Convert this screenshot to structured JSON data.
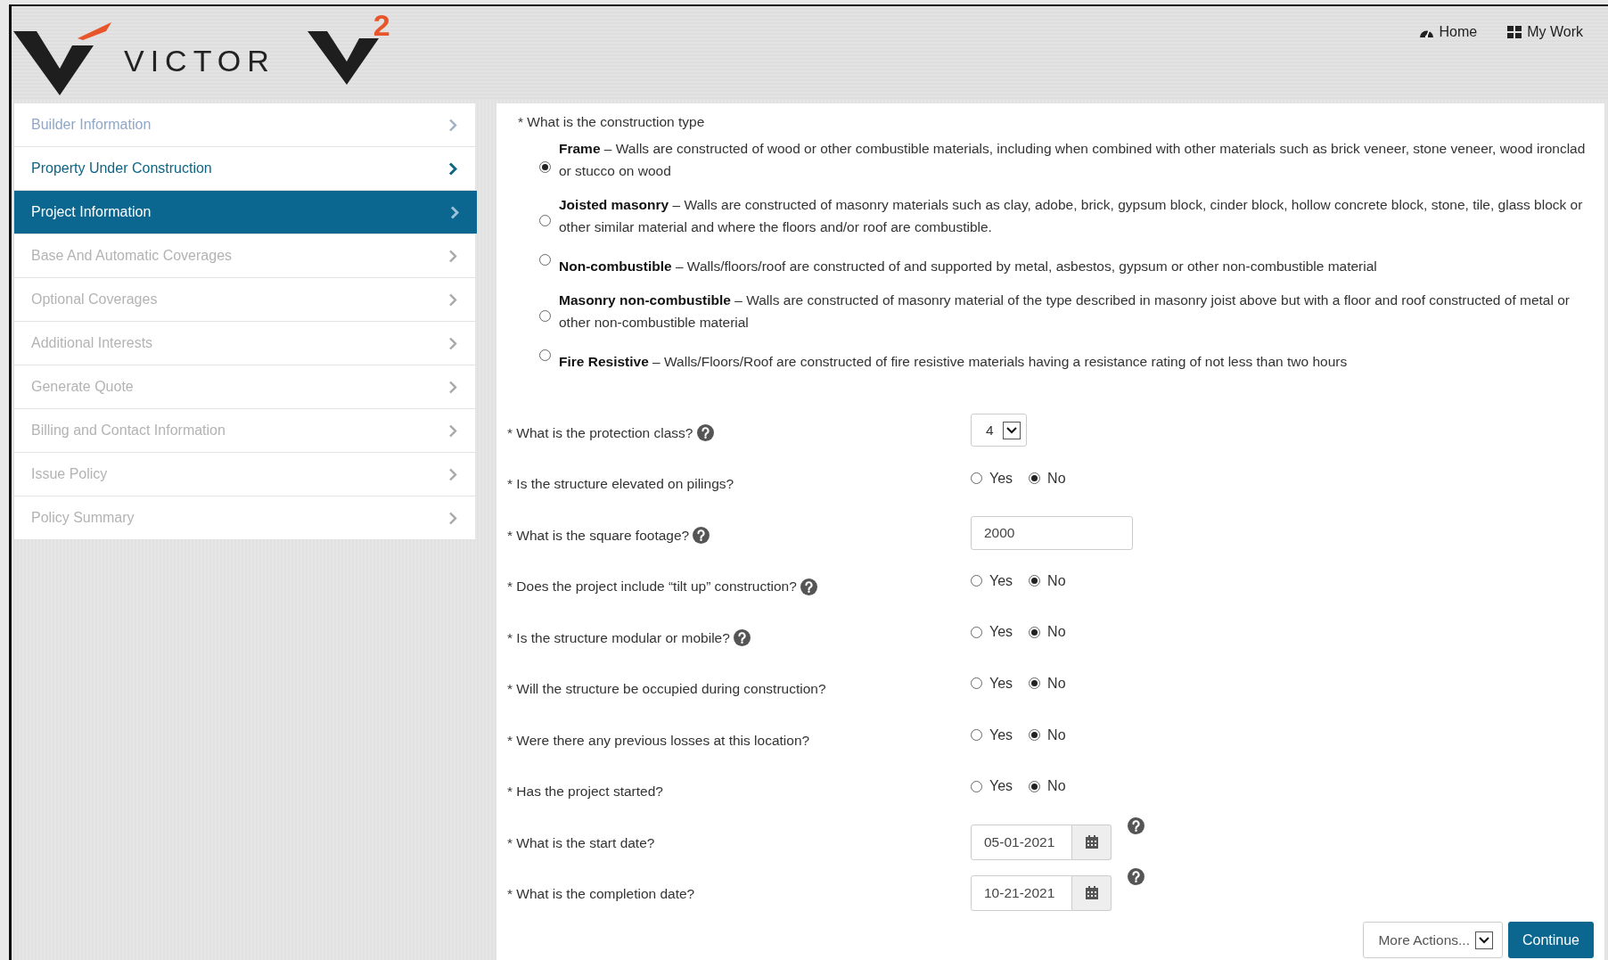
{
  "header": {
    "logo": {
      "wordmark": "VICTOR",
      "superscript": "2"
    },
    "nav": [
      {
        "label": "Home"
      },
      {
        "label": "My Work"
      }
    ]
  },
  "sidebar": {
    "items": [
      {
        "label": "Builder Information",
        "selected": false,
        "visited": true,
        "disabled": false
      },
      {
        "label": "Property Under Construction",
        "selected": false,
        "visited": false,
        "disabled": false
      },
      {
        "label": "Project Information",
        "selected": true,
        "visited": false,
        "disabled": false
      },
      {
        "label": "Base And Automatic Coverages",
        "selected": false,
        "visited": false,
        "disabled": true
      },
      {
        "label": "Optional Coverages",
        "selected": false,
        "visited": false,
        "disabled": true
      },
      {
        "label": "Additional Interests",
        "selected": false,
        "visited": false,
        "disabled": true
      },
      {
        "label": "Generate Quote",
        "selected": false,
        "visited": false,
        "disabled": true
      },
      {
        "label": "Billing and Contact Information",
        "selected": false,
        "visited": false,
        "disabled": true
      },
      {
        "label": "Issue Policy",
        "selected": false,
        "visited": false,
        "disabled": true
      },
      {
        "label": "Policy Summary",
        "selected": false,
        "visited": false,
        "disabled": true
      }
    ]
  },
  "construction_type": {
    "question": "* What is the construction type",
    "options": [
      {
        "text": "**Frame** – Walls are constructed of wood or other combustible materials, including when combined with other materials such as brick veneer, stone veneer, wood ironclad or stucco on wood",
        "selected": true
      },
      {
        "text": "**Joisted masonry** – Walls are constructed of masonry materials such as clay, adobe, brick, gypsum block, cinder block, hollow concrete block, stone, tile, glass block or other similar material and where the floors and/or roof are combustible.",
        "selected": false
      },
      {
        "text": "**Non-combustible** – Walls/floors/roof are constructed of and supported by metal, asbestos, gypsum or other non-combustible material",
        "selected": false
      },
      {
        "text": "**Masonry non-combustible** – Walls are constructed of masonry material of the type described in masonry joist above but with a floor and roof constructed of metal or other non-combustible material",
        "selected": false
      },
      {
        "text": "**Fire Resistive** – Walls/Floors/Roof are constructed of fire resistive materials having a resistance rating of not less than two hours",
        "selected": false
      }
    ]
  },
  "questions": [
    {
      "kind": "select",
      "label": "* What is the protection class?",
      "help": true,
      "value": "4"
    },
    {
      "kind": "yesno",
      "label": "* Is the structure elevated on pilings?",
      "help": false,
      "options": [
        {
          "label": "Yes",
          "selected": false
        },
        {
          "label": "No",
          "selected": true
        }
      ]
    },
    {
      "kind": "text",
      "label": "* What is the square footage?",
      "help": true,
      "value": "2000"
    },
    {
      "kind": "yesno",
      "label": "* Does the project include “tilt up” construction?",
      "help": true,
      "options": [
        {
          "label": "Yes",
          "selected": false
        },
        {
          "label": "No",
          "selected": true
        }
      ]
    },
    {
      "kind": "yesno",
      "label": "* Is the structure modular or mobile?",
      "help": true,
      "options": [
        {
          "label": "Yes",
          "selected": false
        },
        {
          "label": "No",
          "selected": true
        }
      ]
    },
    {
      "kind": "yesno",
      "label": "* Will the structure be occupied during construction?",
      "help": false,
      "options": [
        {
          "label": "Yes",
          "selected": false
        },
        {
          "label": "No",
          "selected": true
        }
      ]
    },
    {
      "kind": "yesno",
      "label": "* Were there any previous losses at this location?",
      "help": false,
      "options": [
        {
          "label": "Yes",
          "selected": false
        },
        {
          "label": "No",
          "selected": true
        }
      ]
    },
    {
      "kind": "yesno",
      "label": "* Has the project started?",
      "help": false,
      "options": [
        {
          "label": "Yes",
          "selected": false
        },
        {
          "label": "No",
          "selected": true
        }
      ]
    },
    {
      "kind": "date",
      "label": "* What is the start date?",
      "help": true,
      "value": "05-01-2021"
    },
    {
      "kind": "date",
      "label": "* What is the completion date?",
      "help": true,
      "value": "10-21-2021"
    }
  ],
  "actions": {
    "more": "More Actions...",
    "primary": "Continue"
  }
}
